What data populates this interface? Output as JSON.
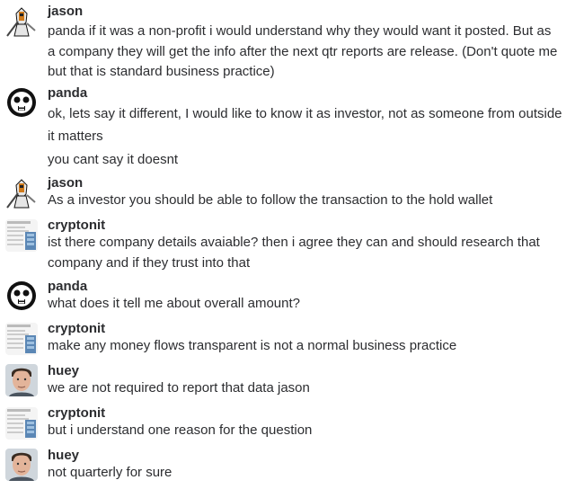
{
  "messages": [
    {
      "author": "jason",
      "avatar": "knight-avatar",
      "lines": [
        "panda if it was a non-profit i would understand why they would want it posted. But as",
        "a company they will get the info after the next qtr reports are release. (Don't quote me",
        "but that is standard business practice)"
      ]
    },
    {
      "author": "panda",
      "avatar": "panda-avatar",
      "lines": [
        "ok, lets say it different, I would like to know it as investor, not as someone from outside",
        "it matters",
        "you cant say it doesnt"
      ]
    },
    {
      "author": "jason",
      "avatar": "knight-avatar",
      "lines": [
        "As a investor you should be able to follow the transaction to the hold wallet"
      ]
    },
    {
      "author": "cryptonit",
      "avatar": "document-avatar",
      "lines": [
        "ist there company details avaiable? then i agree they can and should research that",
        "company and if they trust into that"
      ]
    },
    {
      "author": "panda",
      "avatar": "panda-avatar",
      "lines": [
        "what does it tell me about overall amount?"
      ]
    },
    {
      "author": "cryptonit",
      "avatar": "document-avatar",
      "lines": [
        "make any money flows transparent is not a normal business practice"
      ]
    },
    {
      "author": "huey",
      "avatar": "person-avatar",
      "lines": [
        "we are not required to report that data jason"
      ]
    },
    {
      "author": "cryptonit",
      "avatar": "document-avatar",
      "lines": [
        "but i understand one reason for the question"
      ]
    },
    {
      "author": "huey",
      "avatar": "person-avatar",
      "lines": [
        "not quarterly for sure"
      ]
    }
  ]
}
